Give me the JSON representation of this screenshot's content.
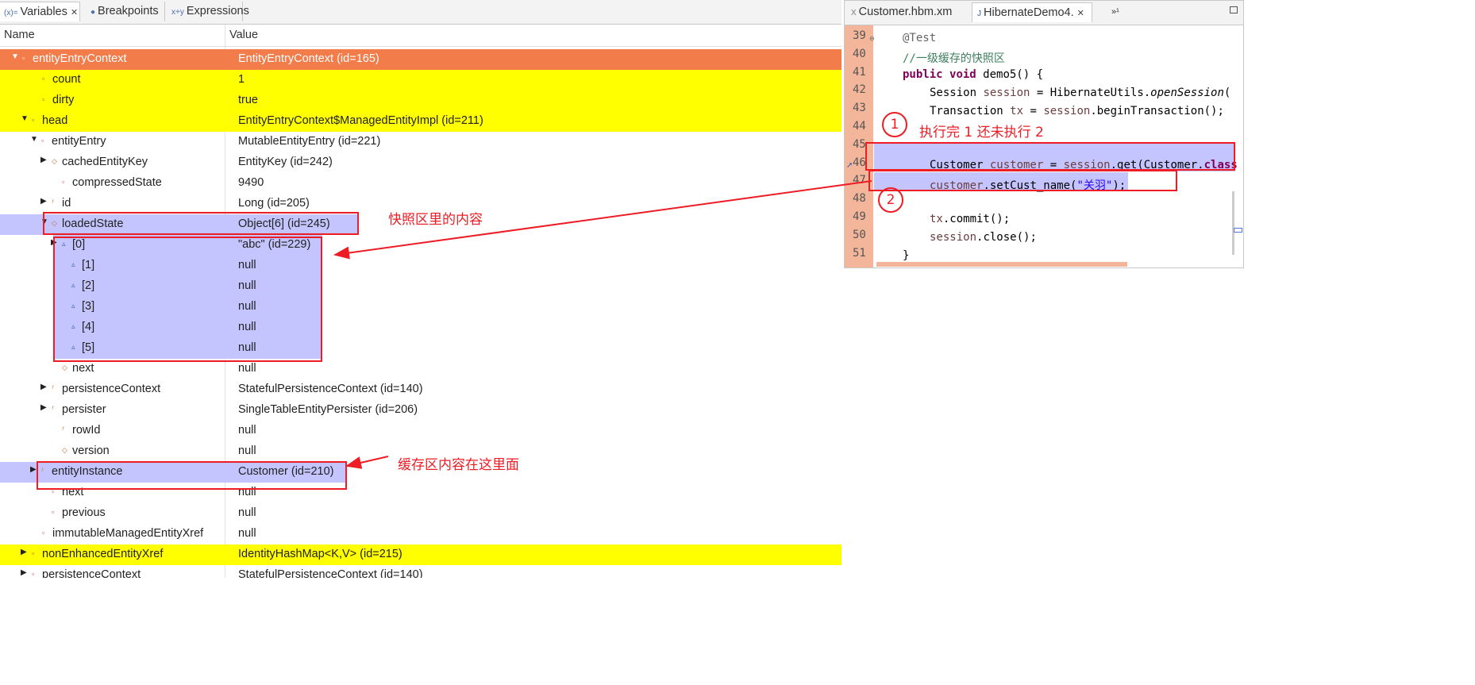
{
  "variables_view": {
    "tabs": [
      {
        "label": "Variables",
        "glyph": "(x)=",
        "active": true,
        "close": "✕"
      },
      {
        "label": "Breakpoints",
        "glyph": "●"
      },
      {
        "label": "Expressions",
        "glyph": "x+y"
      }
    ],
    "columns": {
      "name": "Name",
      "value": "Value"
    },
    "rows": [
      {
        "name": "entityEntryContext",
        "value": "EntityEntryContext  (id=165)"
      },
      {
        "name": "count",
        "value": "1"
      },
      {
        "name": "dirty",
        "value": "true"
      },
      {
        "name": "head",
        "value": "EntityEntryContext$ManagedEntityImpl  (id=211)"
      },
      {
        "name": "entityEntry",
        "value": "MutableEntityEntry  (id=221)"
      },
      {
        "name": "cachedEntityKey",
        "value": "EntityKey  (id=242)"
      },
      {
        "name": "compressedState",
        "value": "9490"
      },
      {
        "name": "id",
        "value": "Long  (id=205)"
      },
      {
        "name": "loadedState",
        "value": "Object[6]  (id=245)"
      },
      {
        "name": "[0]",
        "value": "\"abc\" (id=229)"
      },
      {
        "name": "[1]",
        "value": "null"
      },
      {
        "name": "[2]",
        "value": "null"
      },
      {
        "name": "[3]",
        "value": "null"
      },
      {
        "name": "[4]",
        "value": "null"
      },
      {
        "name": "[5]",
        "value": "null"
      },
      {
        "name": "next",
        "value": "null"
      },
      {
        "name": "persistenceContext",
        "value": "StatefulPersistenceContext  (id=140)"
      },
      {
        "name": "persister",
        "value": "SingleTableEntityPersister  (id=206)"
      },
      {
        "name": "rowId",
        "value": "null"
      },
      {
        "name": "version",
        "value": "null"
      },
      {
        "name": "entityInstance",
        "value": "Customer  (id=210)"
      },
      {
        "name": "next",
        "value": "null"
      },
      {
        "name": "previous",
        "value": "null"
      },
      {
        "name": "immutableManagedEntityXref",
        "value": "null"
      },
      {
        "name": "nonEnhancedEntityXref",
        "value": "IdentityHashMap<K,V>  (id=215)"
      },
      {
        "name": "persistenceContext",
        "value": "StatefulPersistenceContext  (id=140)"
      }
    ],
    "row_highlight": [
      "orange",
      "yellow",
      "yellow",
      "yellow",
      "none",
      "none",
      "none",
      "none",
      "blue",
      "blue",
      "blue",
      "blue",
      "blue",
      "blue",
      "blue",
      "none",
      "none",
      "none",
      "none",
      "none",
      "blue",
      "none",
      "none",
      "none",
      "yellow",
      "none"
    ]
  },
  "annotations": {
    "snapshot_label": "快照区里的内容",
    "cache_label": "缓存区内容在这里面",
    "step_label": "执行完 1 还未执行 2",
    "circle_1": "1",
    "circle_2": "2"
  },
  "editor": {
    "tabs": [
      {
        "label": "Customer.hbm.xm",
        "glyph": "X"
      },
      {
        "label": "HibernateDemo4.",
        "glyph": "J",
        "active": true,
        "close": "✕"
      },
      {
        "label": "»¹"
      }
    ],
    "line_numbers": [
      "39",
      "40",
      "41",
      "42",
      "43",
      "44",
      "45",
      "46",
      "47",
      "48",
      "49",
      "50",
      "51"
    ],
    "colors": {
      "gutter": "#f3b69a",
      "highlight": "#c4c4fe",
      "annotation": "#ee1c25",
      "orange_row": "#f27c4a",
      "yellow_row": "#ffff00"
    }
  }
}
